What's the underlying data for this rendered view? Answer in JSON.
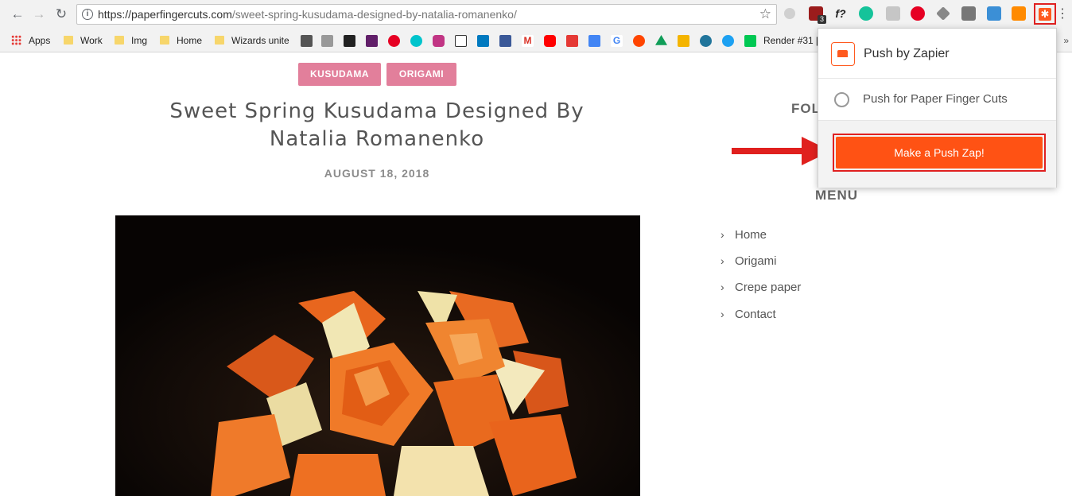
{
  "browser": {
    "url_domain": "https://paperfingercuts.com",
    "url_path": "/sweet-spring-kusudama-designed-by-natalia-romanenko/",
    "extension_badge": "3",
    "font_ext_label": "f?",
    "bookmarks_overflow": "»"
  },
  "bookmarks": [
    {
      "label": "Apps"
    },
    {
      "label": "Work"
    },
    {
      "label": "Img"
    },
    {
      "label": "Home"
    },
    {
      "label": "Wizards unite"
    },
    {
      "label": "Render #31 ["
    }
  ],
  "bookmark_icons": [
    "G"
  ],
  "post": {
    "tags": [
      "KUSUDAMA",
      "ORIGAMI"
    ],
    "title": "Sweet Spring Kusudama Designed By Natalia Romanenko",
    "date": "AUGUST 18, 2018"
  },
  "sidebar": {
    "follow_heading_partial": "FOL",
    "menu_heading": "MENU",
    "menu_items": [
      "Home",
      "Origami",
      "Crepe paper",
      "Contact"
    ]
  },
  "popup": {
    "title": "Push by Zapier",
    "option_label": "Push for Paper Finger Cuts",
    "button_label": "Make a Push Zap!"
  },
  "colors": {
    "tag_bg": "#e27f9b",
    "zapier_orange": "#ff5214",
    "highlight_red": "#e02020"
  }
}
